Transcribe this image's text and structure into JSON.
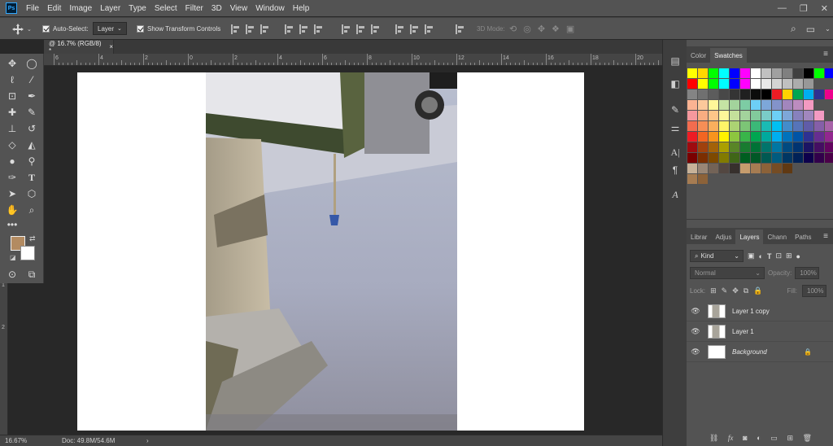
{
  "app": {
    "logo": "Ps"
  },
  "menu": [
    "File",
    "Edit",
    "Image",
    "Layer",
    "Type",
    "Select",
    "Filter",
    "3D",
    "View",
    "Window",
    "Help"
  ],
  "window_controls": {
    "minimize": "—",
    "restore": "❐",
    "close": "✕"
  },
  "options": {
    "auto_select_label": "Auto-Select:",
    "auto_select_checked": true,
    "layer_value": "Layer",
    "show_transform_label": "Show Transform Controls",
    "show_transform_checked": true,
    "mode_3d_label": "3D Mode:"
  },
  "document": {
    "tab_title": "@ 16.7% (RGB/8) *",
    "tab_close": "×"
  },
  "ruler": {
    "h_labels": [
      "6",
      "4",
      "2",
      "0",
      "2",
      "4",
      "6",
      "8",
      "10",
      "12",
      "14",
      "16",
      "18",
      "20"
    ],
    "v_labels": [
      "0",
      "2",
      "4",
      "6",
      "8",
      "1",
      "2"
    ]
  },
  "status": {
    "zoom": "16.67%",
    "doc": "Doc: 49.8M/54.6M",
    "arrow": "›"
  },
  "color_panel": {
    "tabs": [
      "Color",
      "Swatches"
    ],
    "active_tab": "Swatches",
    "swatch_rows": [
      [
        "#ffff00",
        "#ffd700",
        "#00ff00",
        "#00ffff",
        "#0000ff",
        "#ff00ff",
        "#ffffff",
        "#c0c0c0",
        "#a0a0a0",
        "#808080",
        "#404040",
        "#000000",
        "#00ff00",
        "#0000ff",
        "#ff00ff"
      ],
      [
        "#ff0000",
        "#ffff00",
        "#00ff00",
        "#00ffff",
        "#0000ff",
        "#ff00ff",
        "#ffffff",
        "#e8e8e8",
        "#d4d4d4",
        "#c0c0c0",
        "#acacac",
        "#989898"
      ],
      [
        "#848484",
        "#707070",
        "#5c5c5c",
        "#484848",
        "#343434",
        "#202020",
        "#0c0c0c",
        "#000000",
        "#ed1c24",
        "#ffd200",
        "#00a651",
        "#00aeef",
        "#2e3192",
        "#ec008c"
      ],
      [
        "#fbb392",
        "#fcc99b",
        "#fff799",
        "#c5e3a4",
        "#a3d39c",
        "#7dcca4",
        "#6dcff6",
        "#7da7d9",
        "#8393ca",
        "#a286bd",
        "#bc8cbf",
        "#f49ac1"
      ],
      [
        "#f5989d",
        "#f9ad81",
        "#fdc689",
        "#fff79a",
        "#c4df9b",
        "#a3d39c",
        "#82ca9c",
        "#7accc8",
        "#6dcff6",
        "#7ea7d8",
        "#8781bd",
        "#a187be",
        "#f49ac2"
      ],
      [
        "#f26c4f",
        "#f68e56",
        "#fbaf5d",
        "#fff568",
        "#acd373",
        "#7cc576",
        "#3bb878",
        "#1abbb4",
        "#00bff3",
        "#438ccb",
        "#5674b9",
        "#605ca8",
        "#855fa8",
        "#a763a8",
        "#f06eaa"
      ],
      [
        "#ed1c24",
        "#f26522",
        "#f7941d",
        "#fff200",
        "#8dc63f",
        "#39b54a",
        "#00a651",
        "#00a99d",
        "#00aeef",
        "#0072bc",
        "#0054a6",
        "#2e3192",
        "#662d91",
        "#92278f",
        "#ec008c"
      ],
      [
        "#9e0b0f",
        "#a0410d",
        "#a36209",
        "#aba000",
        "#598527",
        "#197b30",
        "#007236",
        "#00746b",
        "#0076a3",
        "#004a80",
        "#003471",
        "#1b1464",
        "#440e62",
        "#630460",
        "#9e005d"
      ],
      [
        "#790000",
        "#7b2e00",
        "#7d4900",
        "#827b00",
        "#406618",
        "#005e20",
        "#005826",
        "#005952",
        "#005b7f",
        "#003663",
        "#002157",
        "#0d004c",
        "#32004b",
        "#4b0049",
        "#7b0046"
      ],
      [
        "#c7b299",
        "#998675",
        "#736357",
        "#534741",
        "#37302d",
        "#c69c6d",
        "#a67c52",
        "#8c6239",
        "#754c24",
        "#603913"
      ],
      [
        "#a67c52",
        "#8c6239"
      ]
    ]
  },
  "layers_panel": {
    "tabs": [
      "Librar",
      "Adjus",
      "Layers",
      "Chann",
      "Paths"
    ],
    "active_tab": "Layers",
    "kind_label": "Kind",
    "blend_mode": "Normal",
    "opacity_label": "Opacity:",
    "opacity_value": "100%",
    "lock_label": "Lock:",
    "fill_label": "Fill:",
    "fill_value": "100%",
    "layers": [
      {
        "name": "Layer 1 copy",
        "italic": false,
        "locked": false
      },
      {
        "name": "Layer 1",
        "italic": false,
        "locked": false
      },
      {
        "name": "Background",
        "italic": true,
        "locked": true
      }
    ]
  },
  "colors": {
    "foreground": "#b38b61",
    "background": "#ffffff",
    "accent": "#31a8ff"
  }
}
